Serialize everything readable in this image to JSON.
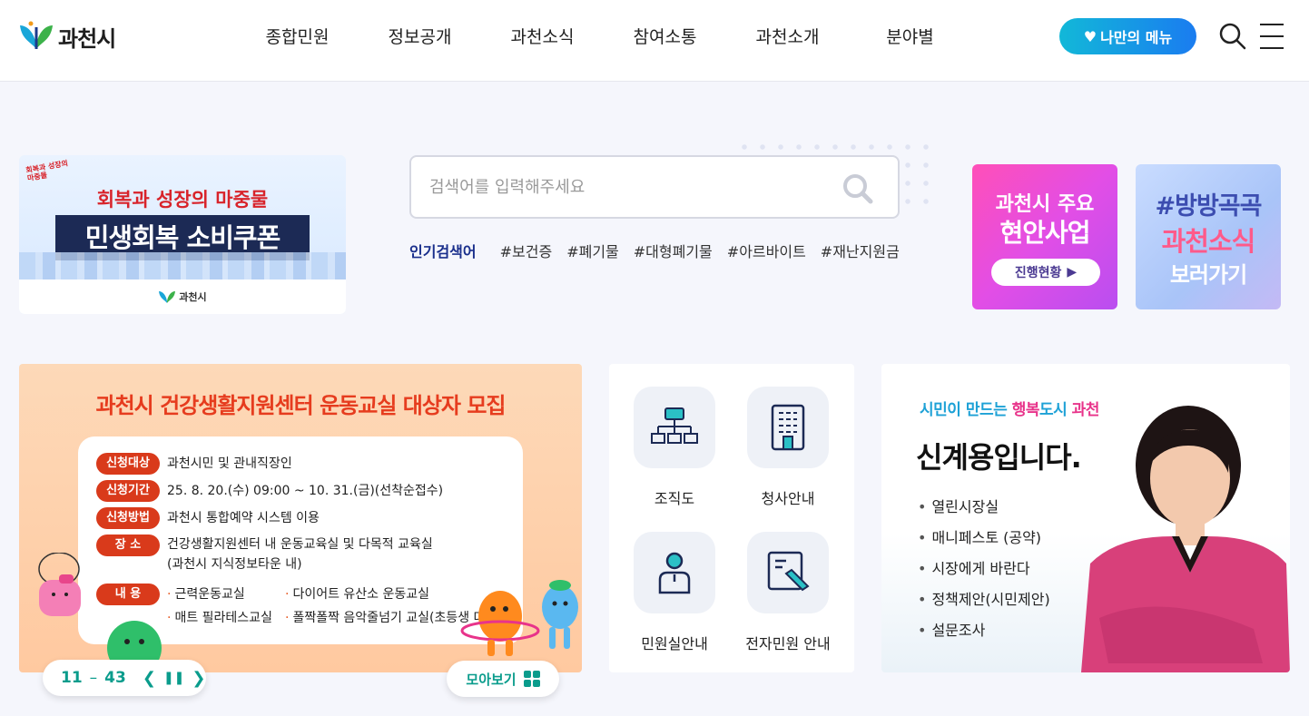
{
  "header": {
    "logo_text": "과천시",
    "nav": [
      "종합민원",
      "정보공개",
      "과천소식",
      "참여소통",
      "과천소개",
      "분야별"
    ],
    "my_menu": "나만의 메뉴"
  },
  "banner_left": {
    "small": "회복과 성장의 마중물",
    "line1": "회복과 성장의 마중물",
    "line2": "민생회복 소비쿠폰",
    "logo": "과천시"
  },
  "search": {
    "placeholder": "검색어를 입력해주세요",
    "popular_label": "인기검색어",
    "tags": [
      "#보건증",
      "#폐기물",
      "#대형폐기물",
      "#아르바이트",
      "#재난지원금"
    ]
  },
  "banner_right1": {
    "line1": "과천시 주요",
    "line2": "현안사업",
    "button": "진행현황"
  },
  "banner_right2": {
    "line1": "#방방곡곡",
    "line2": "과천소식",
    "line3": "보러가기"
  },
  "slide": {
    "title": "과천시 건강생활지원센터 운동교실 대상자 모집",
    "rows": [
      {
        "label": "신청대상",
        "text": "과천시민 및 관내직장인"
      },
      {
        "label": "신청기간",
        "text": "25. 8. 20.(수) 09:00 ~ 10. 31.(금)(선착순접수)"
      },
      {
        "label": "신청방법",
        "text": "과천시 통합예약 시스템 이용"
      },
      {
        "label": "장 소",
        "text": "건강생활지원센터 내 운동교육실 및 다목적 교육실",
        "text2": "(과천시 지식정보타운 내)"
      },
      {
        "label": "내 용",
        "items": [
          "근력운동교실",
          "다이어트 유산소 운동교실",
          "매트 필라테스교실",
          "폴짝폴짝 음악줄넘기 교실(초등생 대상)"
        ]
      }
    ],
    "pager_current": "11",
    "pager_sep": "–",
    "pager_total": "43",
    "all_view": "모아보기"
  },
  "quick": [
    {
      "label": "조직도",
      "icon": "org-chart-icon"
    },
    {
      "label": "청사안내",
      "icon": "building-icon"
    },
    {
      "label": "민원실안내",
      "icon": "person-icon"
    },
    {
      "label": "전자민원 안내",
      "icon": "e-document-icon"
    }
  ],
  "mayor": {
    "slogan_a": "시민이 만드는 ",
    "slogan_b": "행복",
    "slogan_c": "도시 ",
    "slogan_d": "과천",
    "name": "신계용입니다.",
    "links": [
      "열린시장실",
      "매니페스토 (공약)",
      "시장에게 바란다",
      "정책제안(시민제안)",
      "설문조사"
    ]
  },
  "colors": {
    "accent": "#1a2f8c",
    "teal": "#0a9c8c",
    "orange": "#d93a1b"
  }
}
